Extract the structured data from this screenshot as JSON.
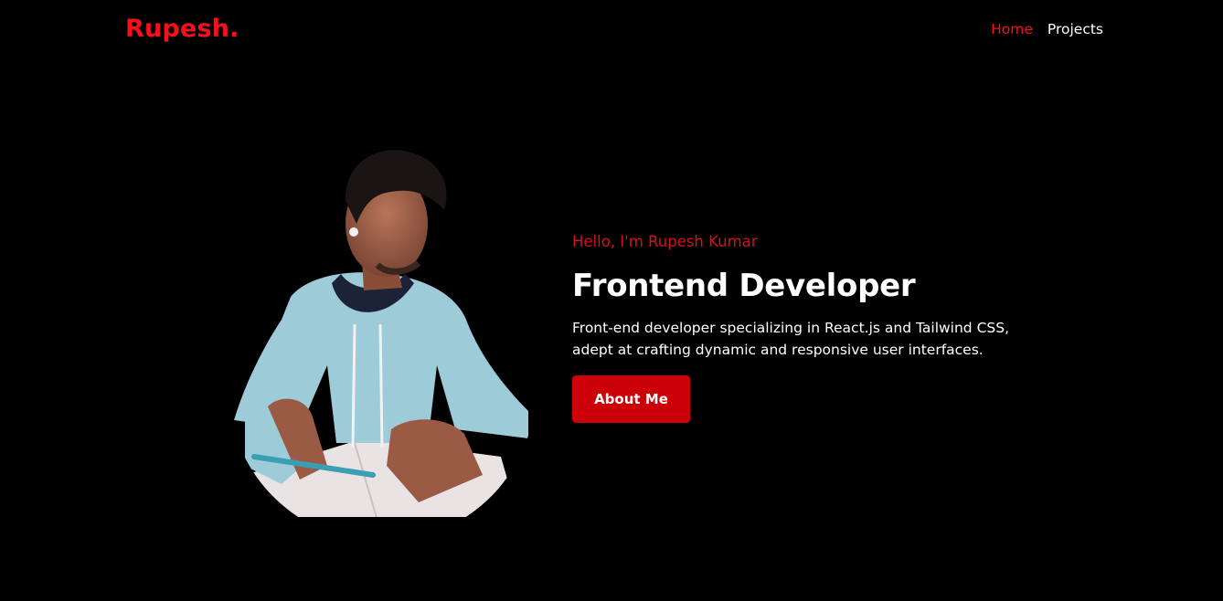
{
  "nav": {
    "logo": "Rupesh.",
    "links": [
      "Home",
      "Projects"
    ],
    "active_link": "Home"
  },
  "hero": {
    "greeting": "Hello, I'm Rupesh Kumar",
    "title": "Frontend Developer",
    "description_line1": "Front-end developer specializing in React.js and Tailwind CSS,",
    "description_line2": "adept at crafting dynamic and responsive user interfaces.",
    "button_label": "About Me",
    "photo_alt": "Rupesh Kumar"
  },
  "colors": {
    "background": "#000000",
    "accent": "#f5101a",
    "button": "#cc0008",
    "text": "#ffffff"
  }
}
